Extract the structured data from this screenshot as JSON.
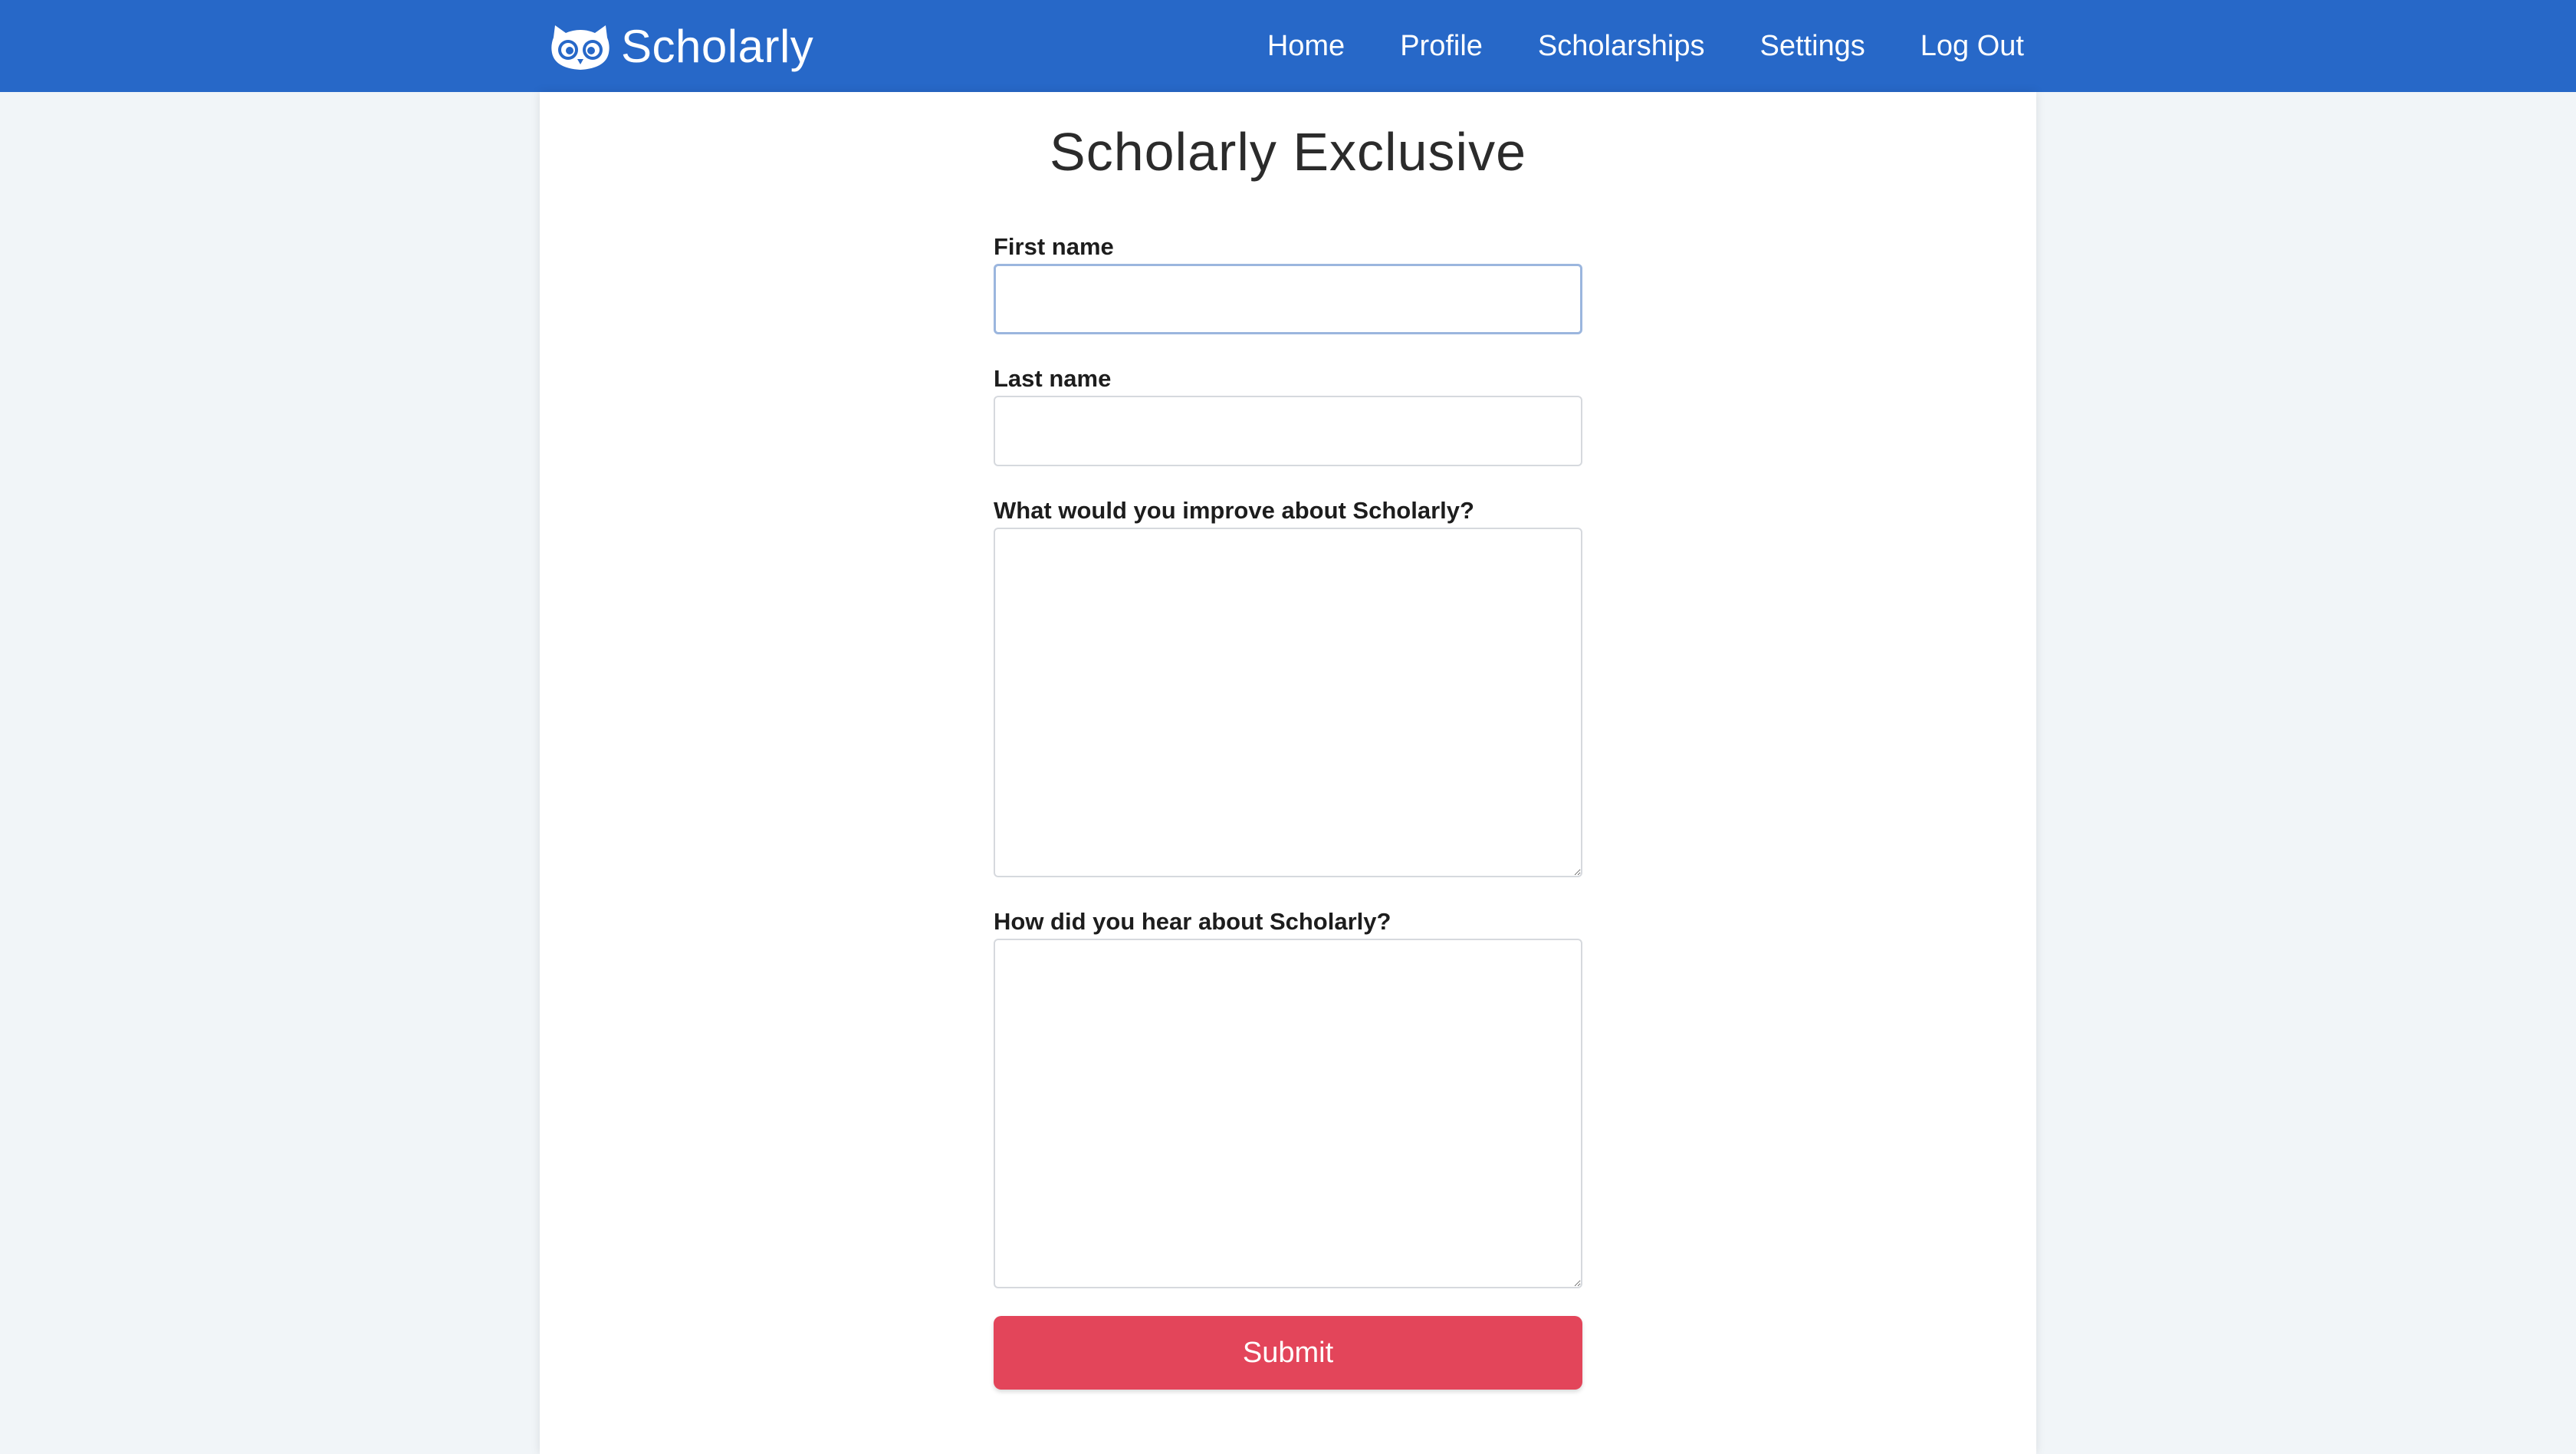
{
  "colors": {
    "navbar": "#2768c8",
    "background": "#f1f5f8",
    "card": "#ffffff",
    "submit": "#e3455a",
    "focus_border": "#9bb6de"
  },
  "header": {
    "logo_icon": "owl-icon",
    "brand": "Scholarly",
    "nav": [
      {
        "label": "Home"
      },
      {
        "label": "Profile"
      },
      {
        "label": "Scholarships"
      },
      {
        "label": "Settings"
      },
      {
        "label": "Log Out"
      }
    ]
  },
  "main": {
    "title": "Scholarly Exclusive",
    "form": {
      "first_name": {
        "label": "First name",
        "value": "",
        "placeholder": ""
      },
      "last_name": {
        "label": "Last name",
        "value": "",
        "placeholder": ""
      },
      "improve": {
        "label": "What would you improve about Scholarly?",
        "value": ""
      },
      "hear": {
        "label": "How did you hear about Scholarly?",
        "value": ""
      },
      "submit_label": "Submit"
    }
  }
}
